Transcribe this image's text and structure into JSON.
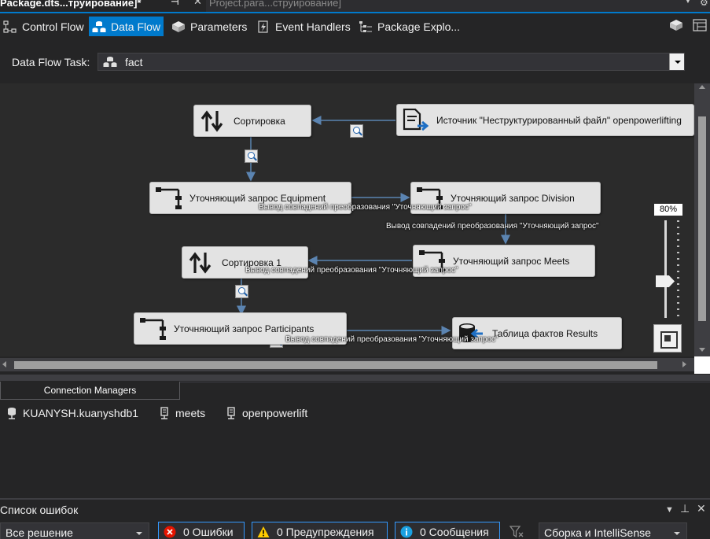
{
  "doc_tabs": {
    "active_label": "Package.dtsx [Конструирование]*",
    "active_display": "Package.dts...труирование]*",
    "inactive_label": "Project.para...струирование]"
  },
  "designer_tabs": [
    {
      "label": "Control Flow",
      "icon": "control-flow-icon",
      "active": false
    },
    {
      "label": "Data Flow",
      "icon": "data-flow-icon",
      "active": true
    },
    {
      "label": "Parameters",
      "icon": "parameters-icon",
      "active": false
    },
    {
      "label": "Event Handlers",
      "icon": "event-handlers-icon",
      "active": false
    },
    {
      "label": "Package Explo...",
      "icon": "package-explorer-icon",
      "active": false
    }
  ],
  "task": {
    "label": "Data Flow Task:",
    "value": "fact"
  },
  "components": {
    "sort": "Сортировка",
    "source": "Источник \"Неструктурированный файл\" openpowerlifting",
    "lookup_equipment": "Уточняющий запрос Equipment",
    "lookup_division": "Уточняющий запрос Division",
    "lookup_meets": "Уточняющий запрос Meets",
    "sort1": "Сортировка 1",
    "lookup_participants": "Уточняющий запрос Participants",
    "dest_results": "Таблица фактов Results"
  },
  "path_labels": {
    "equipment_to_division": "Вывод совпадений преобразования \"Уточняющий запрос\"",
    "division_to_meets": "Вывод совпадений преобразования \"Уточняющий запрос\"",
    "meets_to_sort1": "Вывод совпадений преобразования \"Уточняющий запрос\"",
    "participants_to_results": "Вывод совпадений преобразования \"Уточняющий запрос\""
  },
  "zoom": {
    "level": "80%",
    "value_percent": 80
  },
  "connection_managers": {
    "tab_label": "Connection Managers",
    "items": [
      "KUANYSH.kuanyshdb1",
      "meets",
      "openpowerlift"
    ]
  },
  "error_list": {
    "title": "Список ошибок",
    "scope": "Все решение",
    "errors": "0 Ошибки",
    "warnings": "0 Предупреждения",
    "messages": "0 Сообщения",
    "source": "Сборка и IntelliSense"
  },
  "colors": {
    "accent": "#007acc",
    "canvas": "#2b2b2b",
    "node": "#e3e3e3",
    "flow_arrow": "#5b84b1",
    "error_red": "#e51400",
    "warning_yellow": "#ffcc00",
    "info_blue": "#1ba1e2"
  }
}
